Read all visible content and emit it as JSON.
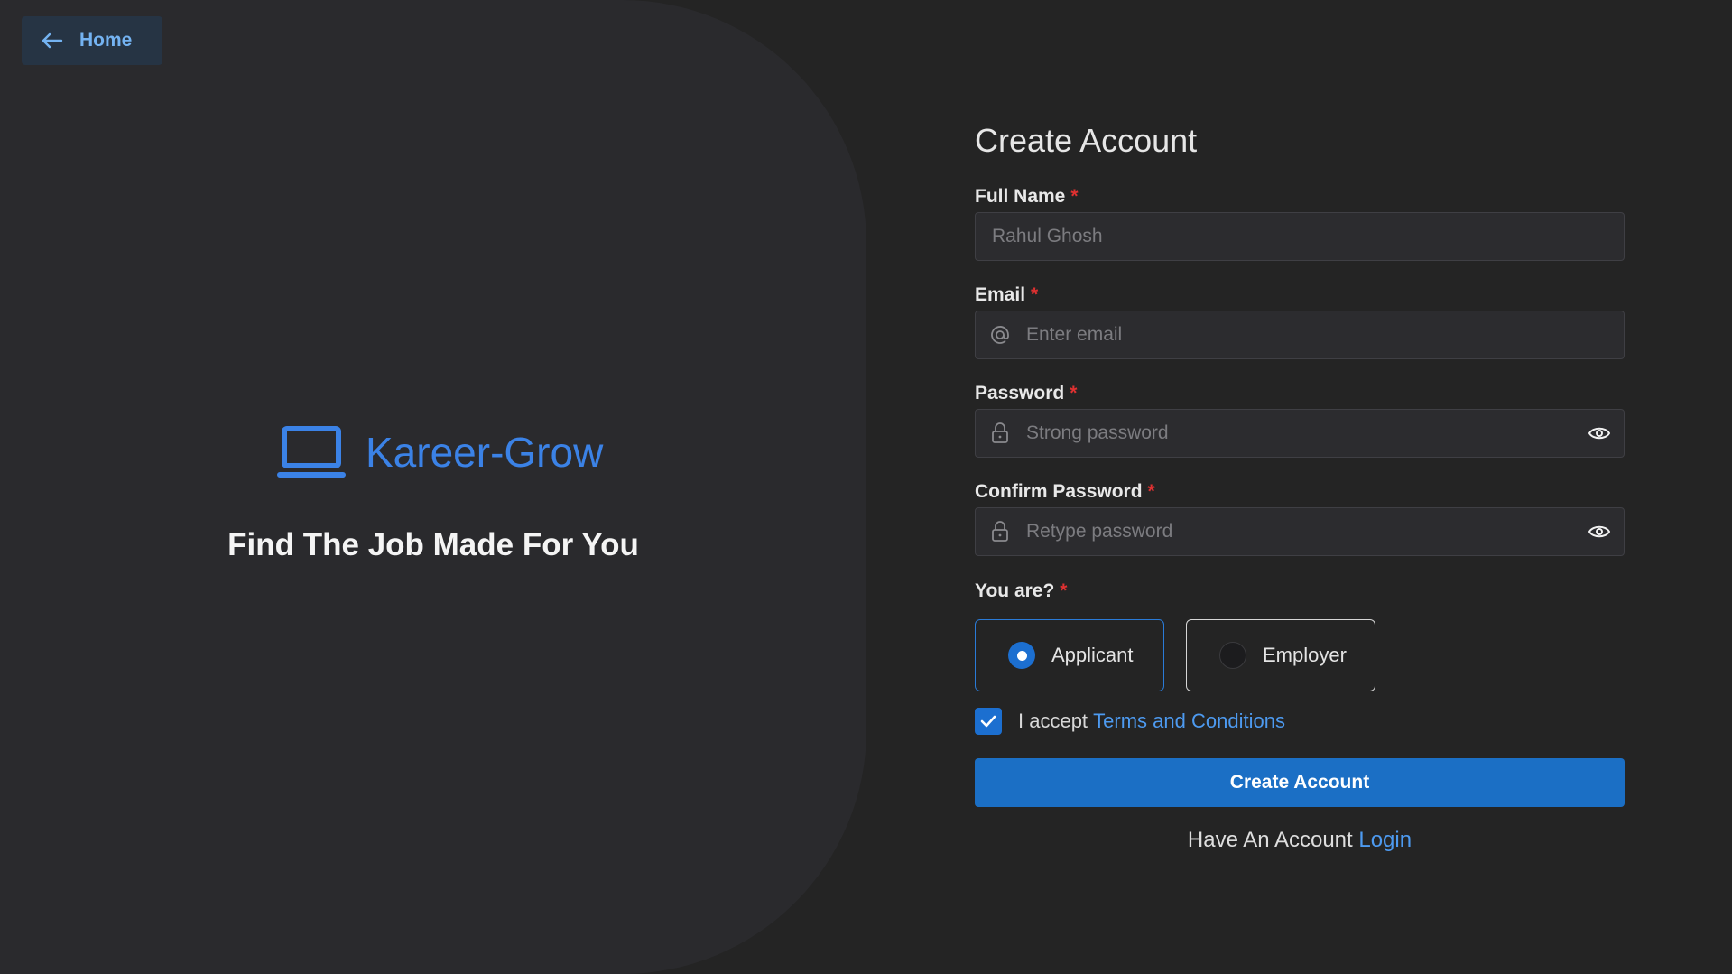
{
  "nav": {
    "home_label": "Home"
  },
  "brand": {
    "name": "Kareer-Grow",
    "tagline": "Find The Job Made For You"
  },
  "form": {
    "title": "Create Account",
    "required_mark": "*",
    "full_name": {
      "label": "Full Name",
      "placeholder": "Rahul Ghosh",
      "value": ""
    },
    "email": {
      "label": "Email",
      "placeholder": "Enter email",
      "value": ""
    },
    "password": {
      "label": "Password",
      "placeholder": "Strong password",
      "value": ""
    },
    "confirm_password": {
      "label": "Confirm Password",
      "placeholder": "Retype password",
      "value": ""
    },
    "role": {
      "label": "You are?",
      "options": [
        "Applicant",
        "Employer"
      ],
      "selected": "Applicant"
    },
    "terms": {
      "prefix": "I accept",
      "link": "Terms and Conditions",
      "checked": true
    },
    "submit_label": "Create Account",
    "login_prompt": {
      "text": "Have An Account",
      "link": "Login"
    }
  },
  "colors": {
    "accent": "#1b6fc5",
    "brand": "#3b82e6",
    "link": "#4d9af0",
    "required": "#e03131",
    "background": "#242424",
    "panel": "#2a2a2d"
  },
  "icons": [
    "arrow-left-icon",
    "laptop-icon",
    "at-icon",
    "lock-icon",
    "eye-icon",
    "check-icon"
  ]
}
